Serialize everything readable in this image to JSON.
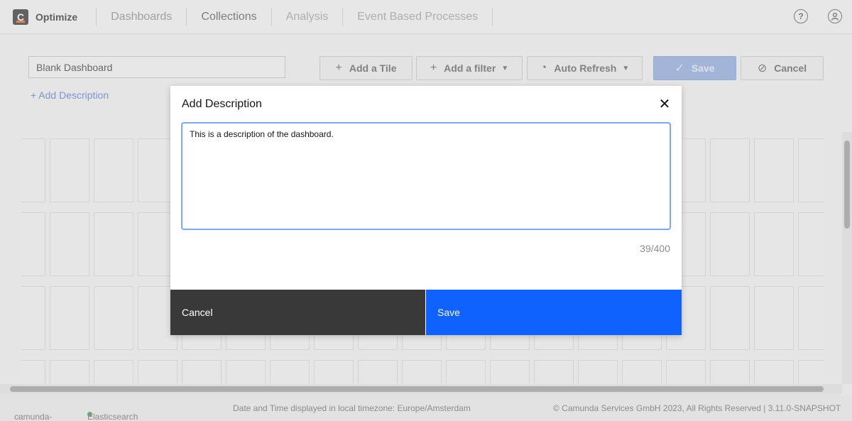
{
  "header": {
    "logo_letter": "C",
    "app_name": "Optimize",
    "nav": [
      "Dashboards",
      "Collections",
      "Analysis",
      "Event Based Processes"
    ],
    "help_icon": "help-icon",
    "user_icon": "user-icon"
  },
  "toolbar": {
    "dashboard_name": "Blank Dashboard",
    "add_description": "+ Add Description",
    "add_tile": "Add a Tile",
    "add_filter": "Add a filter",
    "auto_refresh": "Auto Refresh",
    "save": "Save",
    "cancel": "Cancel"
  },
  "footer": {
    "engine": "camunda-bpm",
    "database": "Elasticsearch",
    "timezone": "Date and Time displayed in local timezone: Europe/Amsterdam",
    "copyright": "© Camunda Services GmbH 2023, All Rights Reserved | 3.11.0-SNAPSHOT"
  },
  "modal": {
    "title": "Add Description",
    "description": "This is a description of the dashboard.",
    "counter": "39/400",
    "cancel": "Cancel",
    "save": "Save"
  },
  "colors": {
    "primary_blue": "#0f62fe",
    "dark_button": "#393939",
    "focus_border": "#78a9ff",
    "status_green": "#2aa44f",
    "logo_accent": "#fc5d0d"
  }
}
